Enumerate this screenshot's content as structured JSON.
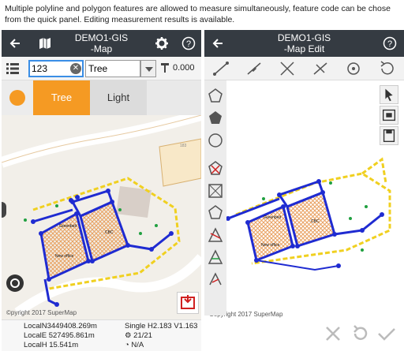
{
  "caption": "Multiple polyline and polygon features are allowed to measure simultaneously, feature code can be chose from the quick panel. Editing measurement results is available.",
  "left": {
    "title_line1": "DEMO1-GIS",
    "title_line2": "-Map",
    "icons": [
      "back-arrow-icon",
      "map-layers-icon",
      "gear-icon",
      "help-icon",
      "list-icon",
      "clear-icon",
      "chevron-down-icon",
      "tape-measure-icon",
      "wheel-icon",
      "measure-export-icon"
    ],
    "code_input_value": "123",
    "type_select_value": "Tree",
    "tape_value": "0.000",
    "quick_panel": {
      "item1": "Tree",
      "item2": "Light",
      "dot_color": "#f59a23",
      "active_color": "#f59a23"
    },
    "map_labels": {
      "tree_bed": "Greenbelt",
      "building_label": "CBC",
      "office_label": "New office",
      "parcel_label": "183"
    },
    "copyright": "©pyright 2017 SuperMap",
    "status": {
      "local_n_label": "LocalN",
      "local_n_value": "3449408.269m",
      "local_e_label": "LocalE",
      "local_e_value": "527495.861m",
      "local_h_label": "LocalH",
      "local_h_value": "15.541m",
      "solution": "Single H2.183 V1.163",
      "satellites": "21/21",
      "age": "N/A"
    }
  },
  "right": {
    "title_line1": "DEMO1-GIS",
    "title_line2": "-Map Edit",
    "icons": [
      "back-arrow-icon",
      "help-icon",
      "line-tool-icon",
      "polyline-tool-icon",
      "cross-tool-icon",
      "split-tool-icon",
      "point-tool-icon",
      "rotate-tool-icon",
      "polygon-outline-icon",
      "polygon-fill-icon",
      "circle-tool-icon",
      "cursor-icon",
      "select-box-icon",
      "save-icon",
      "confirm-icon",
      "undo-icon",
      "cancel-icon"
    ],
    "map_labels": {
      "tree_bed": "Greenbelt",
      "building_label": "CBC",
      "office_label": "New office"
    },
    "copyright": "Copyright 2017 SuperMap"
  },
  "colors": {
    "appbar": "#353b42",
    "feature_line": "#1f2bd1",
    "accent": "#f59a23",
    "hatch": "#e8a060",
    "green_label": "#20a040"
  }
}
